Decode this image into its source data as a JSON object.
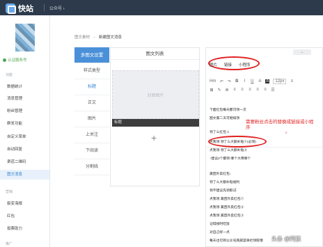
{
  "topbar": {
    "logo_text": "快站",
    "account_menu": "公众号 ›"
  },
  "sidebar": {
    "verified": "认证服务号",
    "groups": [
      "功能",
      "营销",
      "推广"
    ],
    "items": [
      "数据统计",
      "消息管理",
      "粉丝管理",
      "群发功能",
      "自定义菜单",
      "自动回复",
      "渠道二维码",
      "图文消息",
      "裂变海报",
      "红包",
      "投票助力"
    ]
  },
  "breadcrumb": {
    "parent": "图文素材",
    "current": "新建图文消息"
  },
  "tabs": [
    "多图文设置",
    "样式类型",
    "标题",
    "正文",
    "图片",
    "上关注",
    "下阅读",
    "分割线"
  ],
  "article_list": {
    "title": "图文列表",
    "cover_placeholder": "封面图片",
    "cover_caption": "标题",
    "add_symbol": "+"
  },
  "editor": {
    "insert": [
      "图片",
      "链接",
      "小程序"
    ],
    "toolbar_row1": [
      "Hm",
      "↶",
      "↷",
      "B",
      "I",
      "U",
      "A",
      "A",
      "12px",
      "≡"
    ],
    "toolbar_row2": [
      "⊠",
      "✎",
      "≣",
      "≡",
      "≡",
      "≡",
      "≡",
      "≡",
      "☰"
    ],
    "lines": [
      "下面红包每天都可领一次",
      "图文第二天可继续领",
      "领了么红包 1",
      "点我领  领了么大额补贴①(必领)",
      "点我领  领了么大额补贴②",
      "↑建议2个都领 哪个大用哪个",
      "美团外卖红包↓",
      "领了么大额补贴福利",
      "领不建议先领取试",
      "点我领  美团外卖红包①",
      "点我领  美团外卖红包②",
      "点我领  美团外卖红包③",
      "记得按时吃饭",
      "对自己好一点",
      "每天也可到公众号底部菜单栏领取哦"
    ]
  },
  "annotation": "需要粉丝点击的替换成链接或小程序",
  "annotation_mark": "。",
  "watermark": "头条 @阿荻",
  "colors": {
    "accent": "#4a90d9",
    "annotation_red": "#e02020",
    "topbar": "#2d3a4b"
  }
}
